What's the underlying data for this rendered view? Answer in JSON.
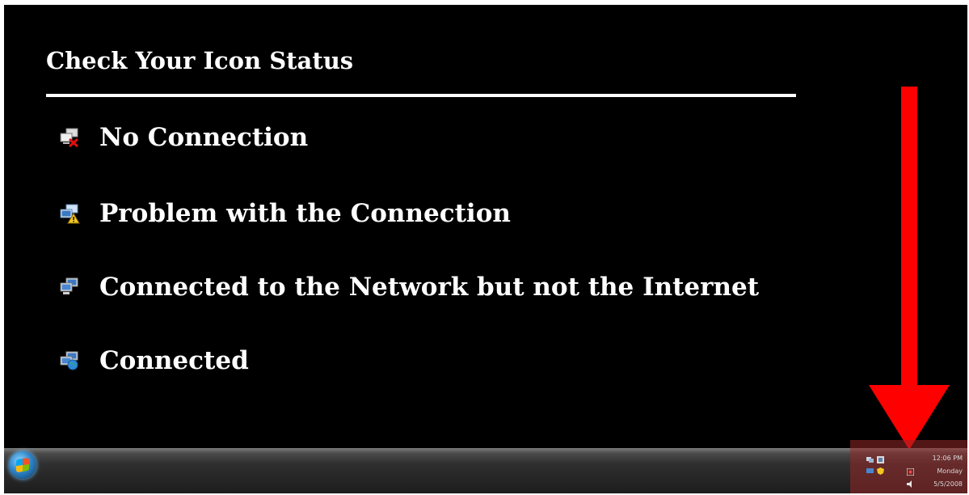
{
  "slide": {
    "title": "Check Your Icon Status",
    "items": [
      {
        "label": "No Connection",
        "icon": "network-no-connection-icon"
      },
      {
        "label": "Problem with the Connection",
        "icon": "network-problem-icon"
      },
      {
        "label": "Connected to the Network but not the Internet",
        "icon": "network-local-only-icon"
      },
      {
        "label": "Connected",
        "icon": "network-connected-icon"
      }
    ]
  },
  "taskbar": {
    "clock_time": "12:06 PM",
    "clock_day": "Monday",
    "clock_date": "5/5/2008"
  },
  "colors": {
    "background": "#000000",
    "text": "#ffffff",
    "arrow": "#ff0000"
  }
}
